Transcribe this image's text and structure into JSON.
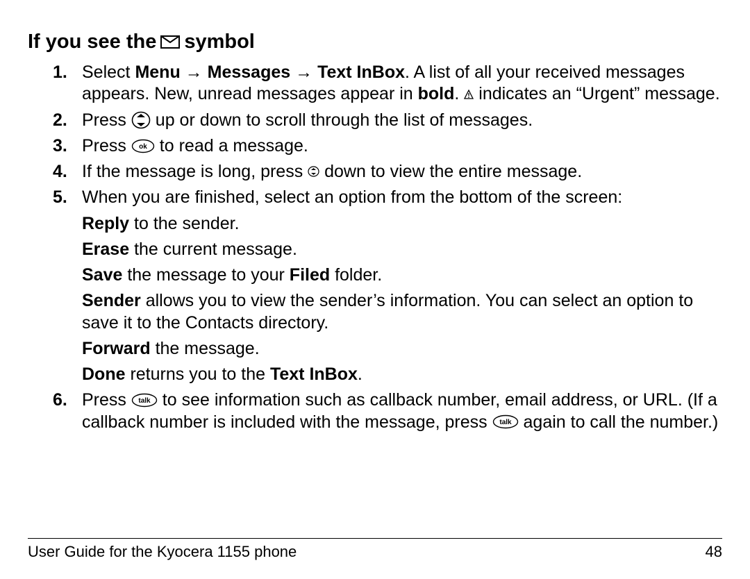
{
  "heading": {
    "pre": "If you see the",
    "post": "symbol"
  },
  "steps": {
    "s1": {
      "t1": "Select ",
      "menu": "Menu",
      "arrow1": " → ",
      "messages": "Messages",
      "arrow2": " → ",
      "inbox": "Text InBox",
      "t2": ". A list of all your received messages appears. New, unread messages appear in ",
      "bold": "bold",
      "t3": ". ",
      "t4": " indicates an “Urgent” message."
    },
    "s2": {
      "t1": "Press ",
      "t2": " up or down to scroll through the list of messages."
    },
    "s3": {
      "t1": "Press ",
      "t2": " to read a message."
    },
    "s4": {
      "t1": "If the message is long, press ",
      "t2": " down to view the entire message."
    },
    "s5": {
      "t1": "When you are finished, select an option from the bottom of the screen:"
    },
    "sub": {
      "reply": {
        "b": "Reply",
        "t": " to the sender."
      },
      "erase": {
        "b": "Erase",
        "t": " the current message."
      },
      "save": {
        "b": "Save",
        "t1": " the message to your ",
        "b2": "Filed",
        "t2": " folder."
      },
      "sender": {
        "b": "Sender",
        "t": " allows you to view the sender’s information. You can select an option to save it to the Contacts directory."
      },
      "fwd": {
        "b": "Forward",
        "t": " the message."
      },
      "done": {
        "b": "Done",
        "t1": " returns you to the ",
        "b2": "Text InBox",
        "t2": "."
      }
    },
    "s6": {
      "t1": "Press ",
      "t2": " to see information such as callback number, email address, or URL. (If a callback number is included with the message, press ",
      "t3": " again to call the number.)"
    }
  },
  "nums": {
    "n1": "1.",
    "n2": "2.",
    "n3": "3.",
    "n4": "4.",
    "n5": "5.",
    "n6": "6."
  },
  "footer": {
    "left": "User Guide for the Kyocera 1155 phone",
    "right": "48"
  }
}
